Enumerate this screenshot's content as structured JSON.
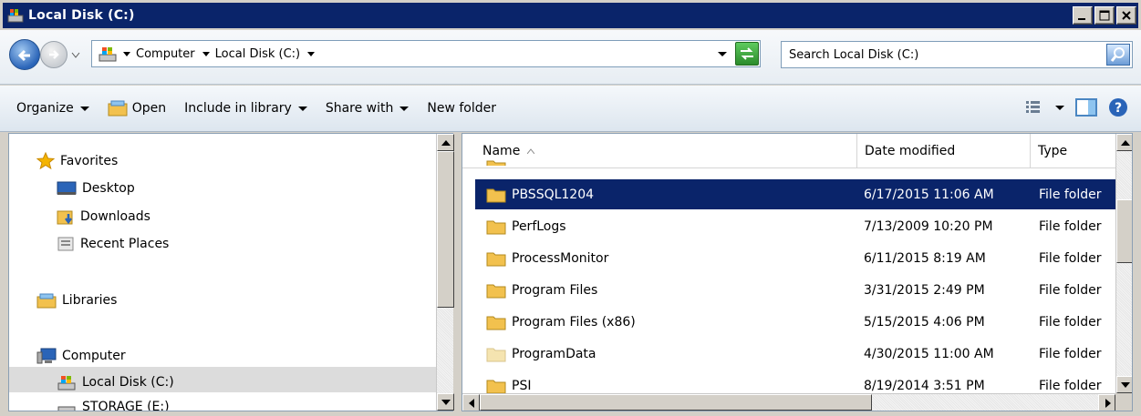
{
  "window": {
    "title": "Local Disk (C:)"
  },
  "address": {
    "breadcrumbs": [
      {
        "label": "Computer"
      },
      {
        "label": "Local Disk (C:)"
      }
    ]
  },
  "search": {
    "placeholder": "Search Local Disk (C:)"
  },
  "toolbar": {
    "organize": "Organize",
    "open": "Open",
    "include_in_library": "Include in library",
    "share_with": "Share with",
    "new_folder": "New folder"
  },
  "nav": {
    "favorites": "Favorites",
    "desktop": "Desktop",
    "downloads": "Downloads",
    "recent_places": "Recent Places",
    "libraries": "Libraries",
    "computer": "Computer",
    "local_disk": "Local Disk (C:)",
    "storage": "STORAGE (E:)"
  },
  "columns": {
    "name": "Name",
    "date_modified": "Date modified",
    "type": "Type"
  },
  "files": [
    {
      "name": "PBSSQL1204",
      "date": "6/17/2015 11:06 AM",
      "type": "File folder",
      "selected": true
    },
    {
      "name": "PerfLogs",
      "date": "7/13/2009 10:20 PM",
      "type": "File folder"
    },
    {
      "name": "ProcessMonitor",
      "date": "6/11/2015 8:19 AM",
      "type": "File folder"
    },
    {
      "name": "Program Files",
      "date": "3/31/2015 2:49 PM",
      "type": "File folder"
    },
    {
      "name": "Program Files (x86)",
      "date": "5/15/2015 4:06 PM",
      "type": "File folder"
    },
    {
      "name": "ProgramData",
      "date": "4/30/2015 11:00 AM",
      "type": "File folder",
      "hidden_attr": true
    },
    {
      "name": "PSI",
      "date": "8/19/2014 3:51 PM",
      "type": "File folder"
    }
  ],
  "colors": {
    "titlebar": "#0a246a",
    "selection": "#0a246a",
    "folder": "#f2c14e"
  }
}
